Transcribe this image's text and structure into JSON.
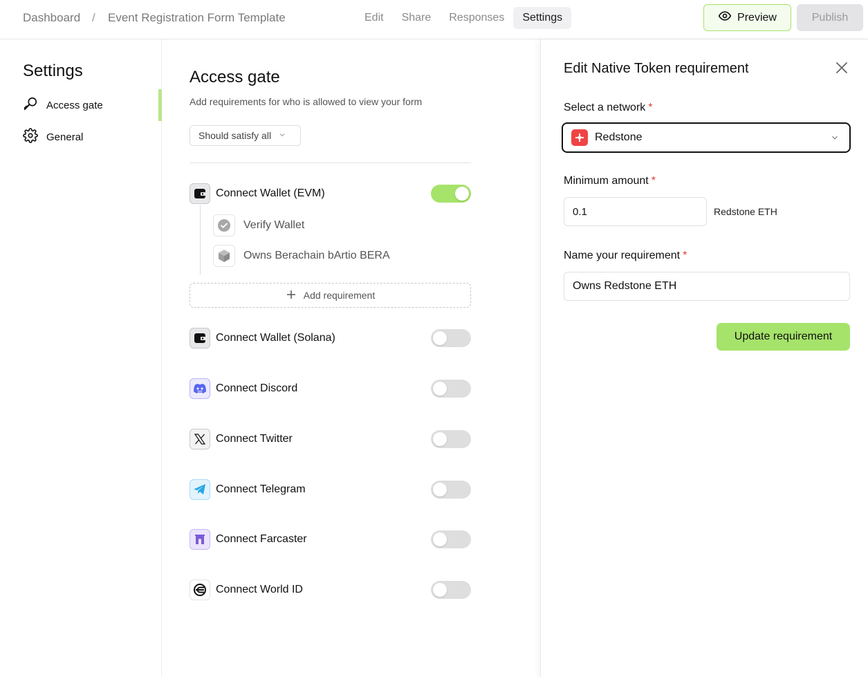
{
  "topbar": {
    "breadcrumb": [
      "Dashboard",
      "Event Registration Form Template"
    ],
    "breadcrumb_separator": "/",
    "tabs": [
      {
        "label": "Edit",
        "active": false
      },
      {
        "label": "Share",
        "active": false
      },
      {
        "label": "Responses",
        "active": false
      },
      {
        "label": "Settings",
        "active": true
      }
    ],
    "preview_label": "Preview",
    "publish_label": "Publish"
  },
  "sidebar": {
    "title": "Settings",
    "items": [
      {
        "label": "Access gate",
        "icon": "key-icon",
        "active": true
      },
      {
        "label": "General",
        "icon": "gear-icon",
        "active": false
      }
    ]
  },
  "access_gate": {
    "title": "Access gate",
    "subtitle": "Add requirements for who is allowed to view your form",
    "satisfy_select": "Should satisfy all",
    "requirements": [
      {
        "label": "Connect Wallet (EVM)",
        "icon": "wallet-icon",
        "enabled": true
      },
      {
        "label": "Connect Wallet (Solana)",
        "icon": "wallet-icon",
        "enabled": false
      },
      {
        "label": "Connect Discord",
        "icon": "discord-icon",
        "enabled": false
      },
      {
        "label": "Connect Twitter",
        "icon": "x-twitter-icon",
        "enabled": false
      },
      {
        "label": "Connect Telegram",
        "icon": "telegram-icon",
        "enabled": false
      },
      {
        "label": "Connect Farcaster",
        "icon": "farcaster-icon",
        "enabled": false
      },
      {
        "label": "Connect World ID",
        "icon": "worldid-icon",
        "enabled": false
      }
    ],
    "sub_requirements": [
      {
        "label": "Verify Wallet",
        "icon": "verified-badge-icon"
      },
      {
        "label": "Owns Berachain bArtio BERA",
        "icon": "cube-icon"
      }
    ],
    "add_requirement_label": "Add requirement"
  },
  "edit_panel": {
    "title": "Edit Native Token requirement",
    "network_label": "Select a network",
    "network_value": "Redstone",
    "min_amount_label": "Minimum amount",
    "min_amount_value": "0.1",
    "min_amount_unit": "Redstone ETH",
    "name_label": "Name your requirement",
    "name_value": "Owns Redstone ETH",
    "required_marker": "*",
    "update_label": "Update requirement"
  },
  "colors": {
    "accent_green": "#a6e36a",
    "required_red": "#e53935",
    "redstone_red": "#ef4444"
  }
}
